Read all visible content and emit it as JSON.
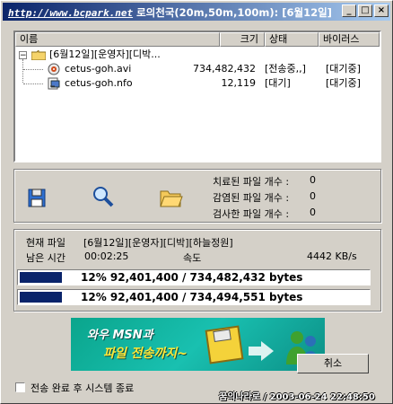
{
  "window": {
    "title_url": "http://www.bcpark.net",
    "title": "로의천국(20m,50m,100m): [6월12일]",
    "minimize_label": "_",
    "maximize_label": "□",
    "close_label": "×"
  },
  "file_list": {
    "columns": [
      "이름",
      "크기",
      "상태",
      "바이러스"
    ],
    "folder_label": "[6월12일][운영자][디박...",
    "rows": [
      {
        "name": "cetus-goh.avi",
        "size": "734,482,432",
        "status": "[전송중,,]",
        "virus": "[대기중]"
      },
      {
        "name": "cetus-goh.nfo",
        "size": "12,119",
        "status": "[대기]",
        "virus": "[대기중]"
      }
    ]
  },
  "stats": {
    "cure_label": "치료된 파일 개수 :",
    "cure_value": "0",
    "infected_label": "감염된 파일 개수 :",
    "infected_value": "0",
    "scanned_label": "검사한 파일 개수 :",
    "scanned_value": "0"
  },
  "transfer": {
    "current_label": "현재 파일",
    "current_value": "[6월12일][운영자][디박][하늘정원]",
    "remaining_label": "남은 시간",
    "remaining_value": "00:02:25",
    "speed_label": "속도",
    "speed_value": "4442 KB/s",
    "progress": [
      {
        "fraction": 0.12,
        "text": "12%    92,401,400 / 734,482,432 bytes"
      },
      {
        "fraction": 0.12,
        "text": "12%    92,401,400 / 734,494,551 bytes"
      }
    ]
  },
  "banner": {
    "line1": "와우 MSN과",
    "line2": "파일 전송까지~"
  },
  "footer": {
    "shutdown_label": "전송 완료 후 시스템 종료",
    "cancel_label": "취소",
    "watermark": "꿈의나라로 / 2003-06-24 22:48:50"
  },
  "colors": {
    "title_start": "#0a246a",
    "progress_fill": "#0a246a",
    "banner_bg": "#14b5a2",
    "banner_text": "#ffe838"
  }
}
